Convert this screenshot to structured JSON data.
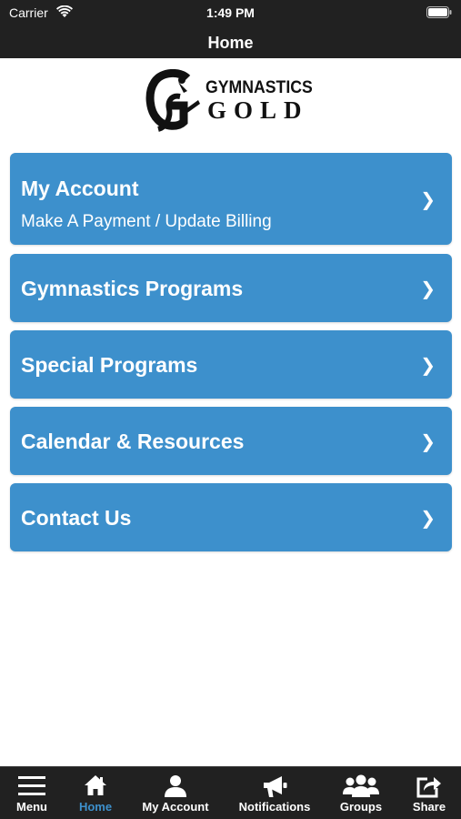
{
  "status_bar": {
    "carrier": "Carrier",
    "time": "1:49 PM"
  },
  "nav": {
    "title": "Home"
  },
  "logo": {
    "word1": "GYMNASTICS",
    "word2": "GOLD"
  },
  "menu": [
    {
      "title": "My Account",
      "subtitle": "Make A Payment / Update Billing",
      "chevron": "❯"
    },
    {
      "title": "Gymnastics Programs",
      "chevron": "❯"
    },
    {
      "title": "Special Programs",
      "chevron": "❯"
    },
    {
      "title": "Calendar & Resources",
      "chevron": "❯"
    },
    {
      "title": "Contact Us",
      "chevron": "❯"
    }
  ],
  "tabs": [
    {
      "label": "Menu",
      "icon": "hamburger-icon"
    },
    {
      "label": "Home",
      "icon": "home-icon",
      "active": true
    },
    {
      "label": "My Account",
      "icon": "user-icon"
    },
    {
      "label": "Notifications",
      "icon": "megaphone-icon"
    },
    {
      "label": "Groups",
      "icon": "group-icon"
    },
    {
      "label": "Share",
      "icon": "share-icon"
    }
  ],
  "colors": {
    "accent": "#3d90cc",
    "bar": "#212121"
  }
}
